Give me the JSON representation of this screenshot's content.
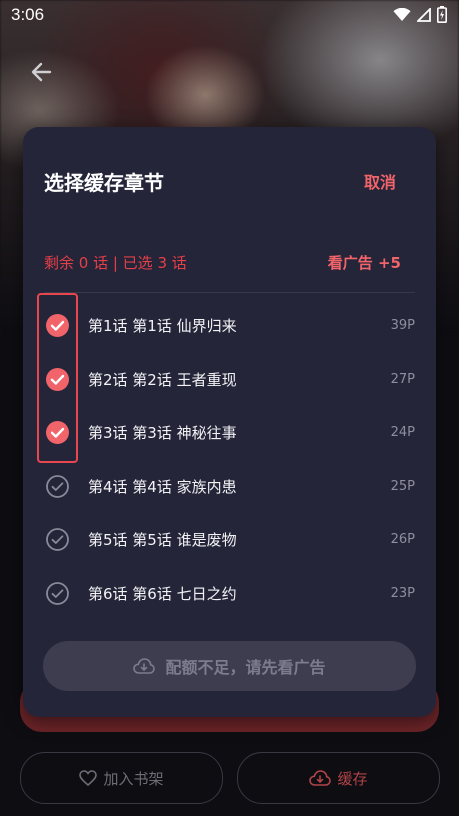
{
  "status_bar": {
    "time": "3:06"
  },
  "modal": {
    "title": "选择缓存章节",
    "cancel_label": "取消",
    "quota_text": "剩余 0 话 | 已选 3 话",
    "ad_label": "看广告 +5",
    "chapters": [
      {
        "title": "第1话 第1话 仙界归来",
        "pages": "39P",
        "selected": true
      },
      {
        "title": "第2话 第2话 王者重现",
        "pages": "27P",
        "selected": true
      },
      {
        "title": "第3话 第3话 神秘往事",
        "pages": "24P",
        "selected": true
      },
      {
        "title": "第4话 第4话 家族内患",
        "pages": "25P",
        "selected": false
      },
      {
        "title": "第5话 第5话 谁是废物",
        "pages": "26P",
        "selected": false
      },
      {
        "title": "第6话 第6话 七日之约",
        "pages": "23P",
        "selected": false
      }
    ],
    "action_label": "配额不足，请先看广告"
  },
  "bottom_bar": {
    "shelf_label": "加入书架",
    "cache_label": "缓存"
  },
  "colors": {
    "accent": "#f0646a",
    "quota_red": "#e53f47",
    "modal_bg": "#25253a"
  }
}
